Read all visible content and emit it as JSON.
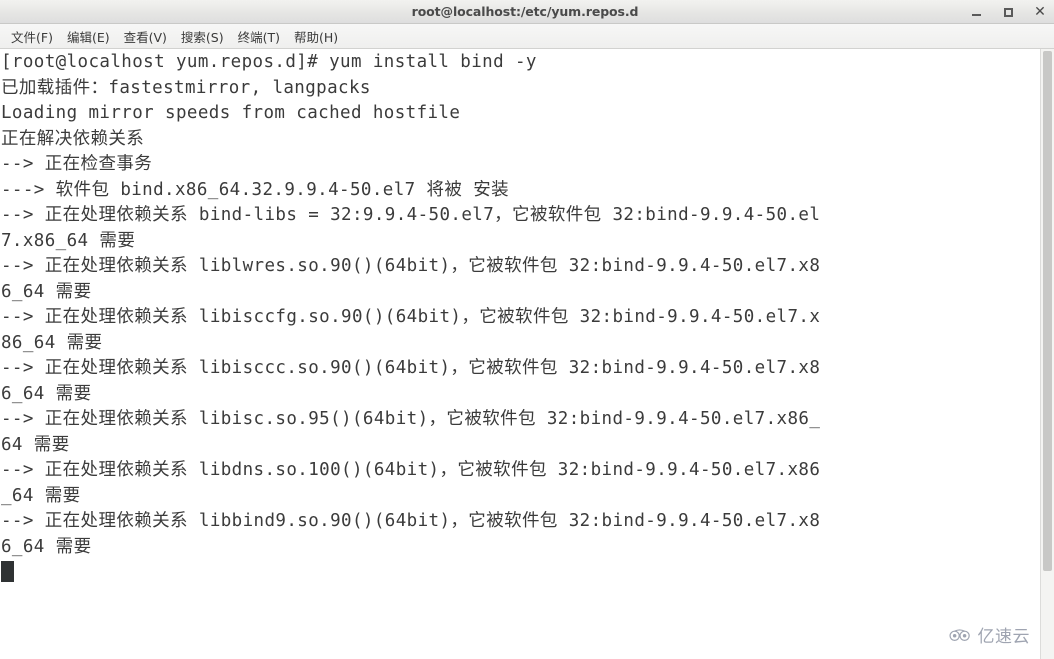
{
  "window": {
    "title": "root@localhost:/etc/yum.repos.d",
    "controls": {
      "minimize_label": "–",
      "maximize_label": "□",
      "close_label": "✕"
    }
  },
  "menu": {
    "items": [
      {
        "label": "文件(F)"
      },
      {
        "label": "编辑(E)"
      },
      {
        "label": "查看(V)"
      },
      {
        "label": "搜索(S)"
      },
      {
        "label": "终端(T)"
      },
      {
        "label": "帮助(H)"
      }
    ]
  },
  "terminal": {
    "prompt": "[root@localhost yum.repos.d]#",
    "command": "yum install bind -y",
    "lines": [
      "[root@localhost yum.repos.d]# yum install bind -y",
      "已加载插件：fastestmirror, langpacks",
      "Loading mirror speeds from cached hostfile",
      "正在解决依赖关系",
      "--> 正在检查事务",
      "---> 软件包 bind.x86_64.32.9.9.4-50.el7 将被 安装",
      "--> 正在处理依赖关系 bind-libs = 32:9.9.4-50.el7，它被软件包 32:bind-9.9.4-50.el",
      "7.x86_64 需要",
      "--> 正在处理依赖关系 liblwres.so.90()(64bit)，它被软件包 32:bind-9.9.4-50.el7.x8",
      "6_64 需要",
      "--> 正在处理依赖关系 libisccfg.so.90()(64bit)，它被软件包 32:bind-9.9.4-50.el7.x",
      "86_64 需要",
      "--> 正在处理依赖关系 libisccc.so.90()(64bit)，它被软件包 32:bind-9.9.4-50.el7.x8",
      "6_64 需要",
      "--> 正在处理依赖关系 libisc.so.95()(64bit)，它被软件包 32:bind-9.9.4-50.el7.x86_",
      "64 需要",
      "--> 正在处理依赖关系 libdns.so.100()(64bit)，它被软件包 32:bind-9.9.4-50.el7.x86",
      "_64 需要",
      "--> 正在处理依赖关系 libbind9.so.90()(64bit)，它被软件包 32:bind-9.9.4-50.el7.x8",
      "6_64 需要"
    ]
  },
  "watermark": {
    "text": "亿速云"
  },
  "colors": {
    "terminal_bg": "#ffffff",
    "terminal_fg": "#3b3b3b",
    "titlebar_bg": "#e8e8e6",
    "cursor": "#2f3233",
    "watermark": "#9aa0ad"
  }
}
